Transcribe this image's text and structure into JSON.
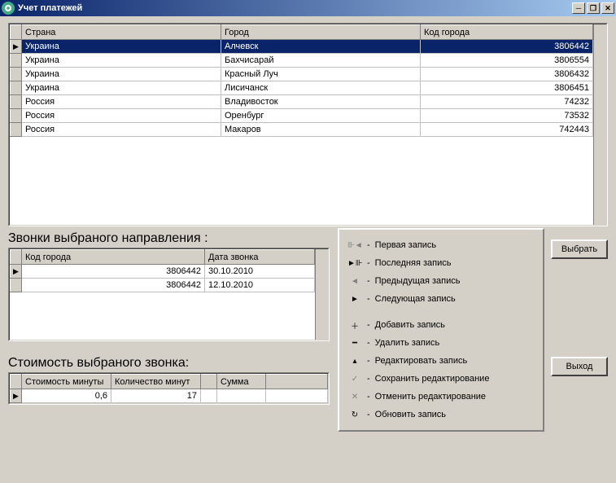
{
  "window": {
    "title": "Учет платежей"
  },
  "main_table": {
    "headers": [
      "Страна",
      "Город",
      "Код города"
    ],
    "rows": [
      {
        "country": "Украина",
        "city": "Алчевск",
        "code": "3806442",
        "selected": true
      },
      {
        "country": "Украина",
        "city": "Бахчисарай",
        "code": "3806554"
      },
      {
        "country": "Украина",
        "city": "Красный Луч",
        "code": "3806432"
      },
      {
        "country": "Украина",
        "city": "Лисичанск",
        "code": "3806451"
      },
      {
        "country": "Россия",
        "city": "Владивосток",
        "code": "74232"
      },
      {
        "country": "Россия",
        "city": "Оренбург",
        "code": "73532"
      },
      {
        "country": "Россия",
        "city": "Макаров",
        "code": "742443"
      }
    ]
  },
  "calls_section": {
    "title": "Звонки выбраного направления :",
    "headers": [
      "Код города",
      "Дата звонка"
    ],
    "rows": [
      {
        "code": "3806442",
        "date": "30.10.2010",
        "current": true
      },
      {
        "code": "3806442",
        "date": "12.10.2010"
      }
    ]
  },
  "cost_section": {
    "title": "Стоимость выбраного звонка:",
    "headers": [
      "Стоимость минуты",
      "Количество минут",
      "Сумма"
    ],
    "row": {
      "price": "0,6",
      "qty": "17",
      "sum": ""
    }
  },
  "nav": {
    "items": [
      {
        "icon": "⊪◄",
        "label": "Первая запись",
        "active": false
      },
      {
        "icon": "►⊪",
        "label": "Последняя запись",
        "active": true
      },
      {
        "icon": "◄",
        "label": "Предыдущая запись",
        "active": false
      },
      {
        "icon": "►",
        "label": "Следующая запись",
        "active": true
      },
      {
        "icon": "＋",
        "label": "Добавить запись",
        "active": true
      },
      {
        "icon": "━",
        "label": "Удалить запись",
        "active": true
      },
      {
        "icon": "▴",
        "label": "Редактировать запись",
        "active": true
      },
      {
        "icon": "✓",
        "label": "Сохранить редактирование",
        "active": false
      },
      {
        "icon": "✕",
        "label": "Отменить редактирование",
        "active": false
      },
      {
        "icon": "↻",
        "label": "Обновить запись",
        "active": true
      }
    ]
  },
  "buttons": {
    "select": "Выбрать",
    "exit": "Выход"
  }
}
